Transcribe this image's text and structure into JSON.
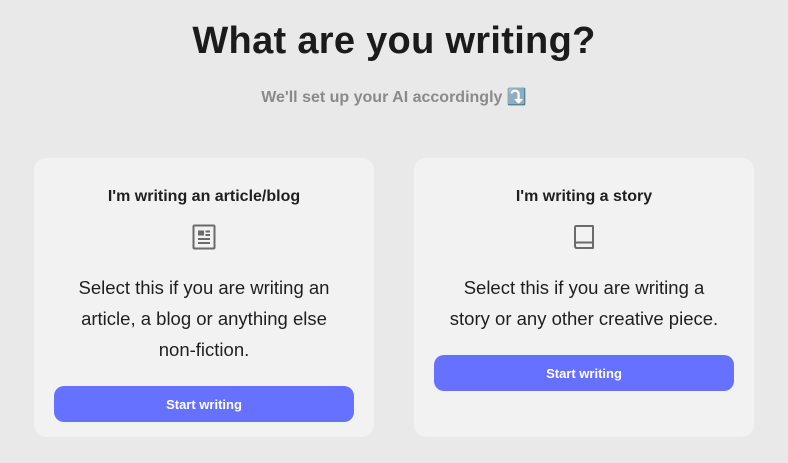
{
  "header": {
    "title": "What are you writing?",
    "subtitle": "We'll set up your AI accordingly ⤵️"
  },
  "cards": [
    {
      "title": "I'm writing an article/blog",
      "icon": "article-icon",
      "description": "Select this if you are writing an article, a blog or anything else non-fiction.",
      "button_label": "Start writing"
    },
    {
      "title": "I'm writing a story",
      "icon": "book-icon",
      "description": "Select this if you are writing a story or any other creative piece.",
      "button_label": "Start writing"
    }
  ],
  "colors": {
    "background": "#e9e9e9",
    "card": "#f2f2f2",
    "accent": "#6672ff",
    "subtitle": "#8a8a8a",
    "icon": "#6b6b6b"
  }
}
